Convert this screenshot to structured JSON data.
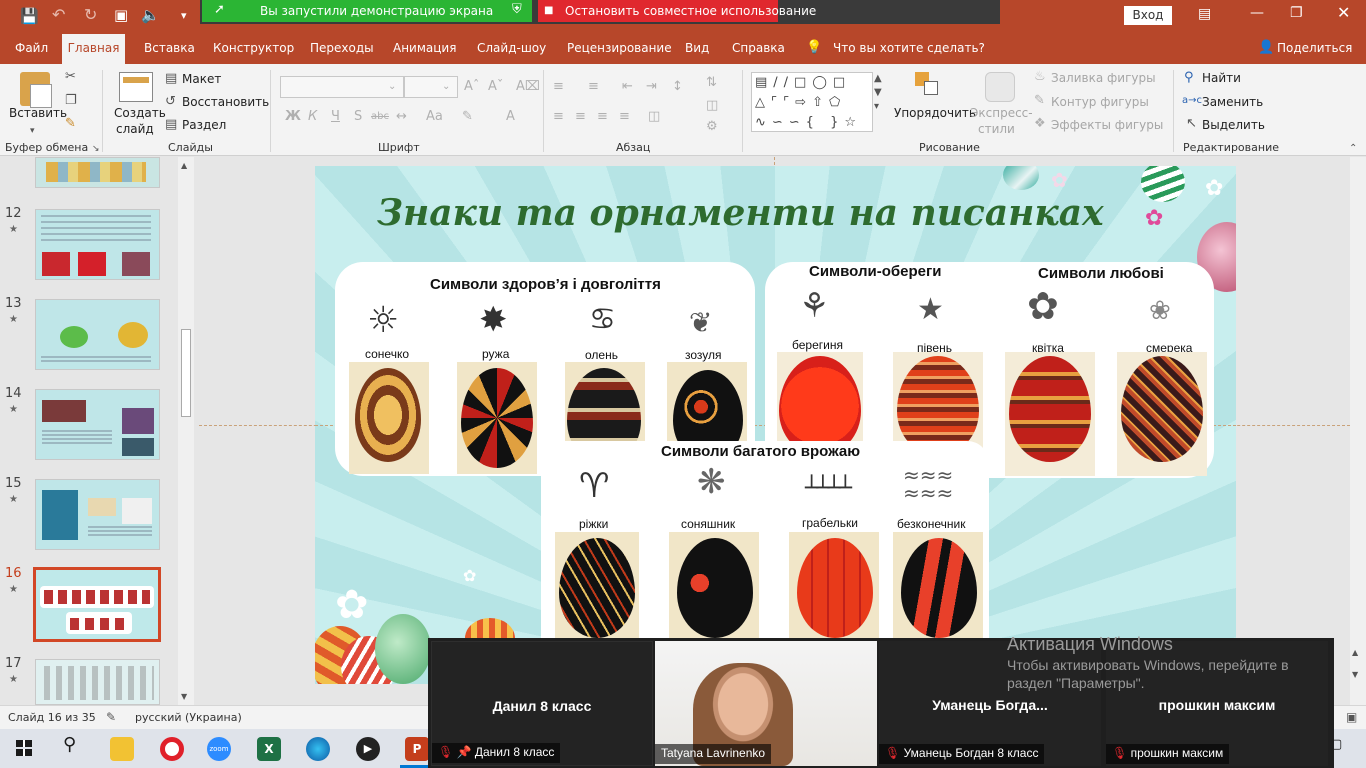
{
  "titlebar": {
    "share_status": "Вы запустили демонстрацию экрана",
    "stop_share": "Остановить совместное использование",
    "signin": "Вход"
  },
  "tabs": [
    "Файл",
    "Главная",
    "Вставка",
    "Конструктор",
    "Переходы",
    "Анимация",
    "Слайд-шоу",
    "Рецензирование",
    "Вид",
    "Справка"
  ],
  "tell_me": "Что вы хотите сделать?",
  "share_button": "Поделиться",
  "ribbon": {
    "clipboard": {
      "paste": "Вставить",
      "label": "Буфер обмена"
    },
    "slides": {
      "new_slide_1": "Создать",
      "new_slide_2": "слайд",
      "layout": "Макет",
      "reset": "Восстановить",
      "section": "Раздел",
      "label": "Слайды"
    },
    "font": {
      "label": "Шрифт",
      "bold": "Ж",
      "italic": "К",
      "underline": "Ч",
      "strike": "S",
      "spacing": "abc",
      "case": "Aa"
    },
    "paragraph": {
      "label": "Абзац"
    },
    "drawing": {
      "arrange": "Упорядочить",
      "quick_styles_1": "Экспресс-",
      "quick_styles_2": "стили",
      "fill": "Заливка фигуры",
      "outline": "Контур фигуры",
      "effects": "Эффекты фигуры",
      "label": "Рисование"
    },
    "editing": {
      "find": "Найти",
      "replace": "Заменить",
      "select": "Выделить",
      "label": "Редактирование"
    }
  },
  "thumbnails": [
    {
      "num": "12"
    },
    {
      "num": "13"
    },
    {
      "num": "14"
    },
    {
      "num": "15"
    },
    {
      "num": "16",
      "selected": true
    },
    {
      "num": "17"
    }
  ],
  "slide": {
    "title": "Знаки та орнаменти на писанках",
    "card_health": {
      "title": "Символи здоров’я і довголіття",
      "items": [
        "сонечко",
        "ружа",
        "олень",
        "зозуля"
      ]
    },
    "card_amulet": {
      "title": "Символи-обереги",
      "items": [
        "берегиня",
        "півень"
      ]
    },
    "card_love": {
      "title": "Символи любові",
      "items": [
        "квітка",
        "смерека"
      ]
    },
    "card_harvest": {
      "title": "Символи багатого врожаю",
      "items": [
        "ріжки",
        "соняшник",
        "грабельки",
        "безконечник"
      ]
    }
  },
  "statusbar": {
    "slide_info": "Слайд 16 из 35",
    "language": "русский (Украина)"
  },
  "zoom": {
    "participants": [
      {
        "display": "Данил 8 класс",
        "label": "Данил 8 класс"
      },
      {
        "display": "",
        "label": "Tatyana Lavrinenko"
      },
      {
        "display": "Уманець  Богда...",
        "label": "Уманець Богдан 8 класс"
      },
      {
        "display": "прошкин максим",
        "label": "прошкин максим"
      }
    ]
  },
  "windows_activation": {
    "title": "Активация Windows",
    "line1": "Чтобы активировать Windows, перейдите в",
    "line2": "раздел \"Параметры\"."
  },
  "colors": {
    "accent": "#b7472a",
    "slide_bg": "#bfe9ea",
    "title_green": "#2e6b2f",
    "share_green": "#2bb534",
    "share_red": "#e0282e"
  }
}
